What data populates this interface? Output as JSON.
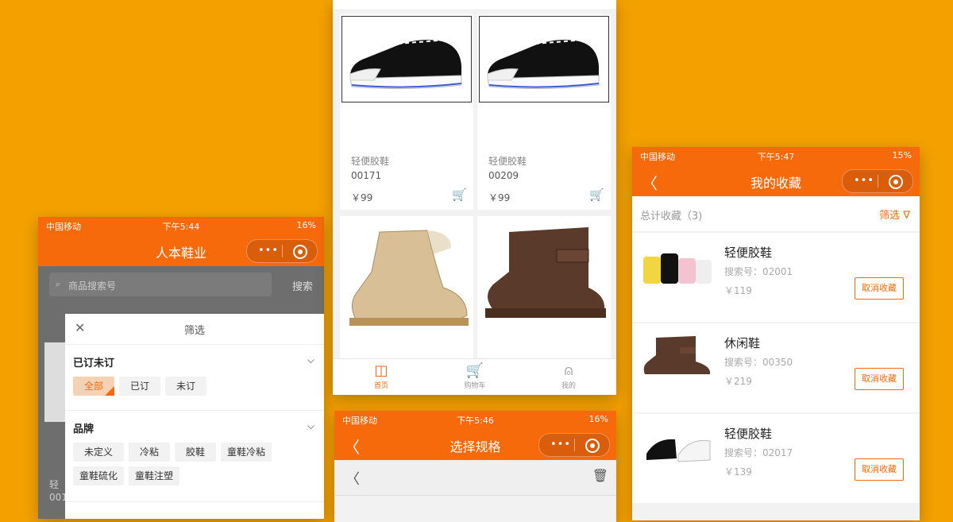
{
  "colors": {
    "background": "#F4A100",
    "brand": "#F76A0C"
  },
  "icons": {
    "close": "✕",
    "chevron_down": "⌵",
    "back": "〈",
    "cart": "🛒",
    "trash": "🗑",
    "filter": "∇",
    "search": "⌕",
    "signal": "ıll",
    "wifi": "◠"
  },
  "screen1": {
    "status": {
      "carrier": "中国移动",
      "time": "下午5:44",
      "battery": "16%"
    },
    "title": "人本鞋业",
    "search": {
      "placeholder": "商品搜索号",
      "button": "搜索"
    },
    "bg_text": {
      "line1": "轻",
      "line2": "001"
    },
    "filter": {
      "title": "筛选",
      "sections": [
        {
          "title": "已订未订",
          "options": [
            "全部",
            "已订",
            "未订"
          ],
          "selected": "全部"
        },
        {
          "title": "品牌",
          "options": [
            "未定义",
            "冷粘",
            "胶鞋",
            "童鞋冷粘",
            "童鞋硫化",
            "童鞋注塑"
          ]
        }
      ]
    }
  },
  "screen2": {
    "products": [
      {
        "name": "轻便胶鞋",
        "code": "00171",
        "price": "￥99"
      },
      {
        "name": "轻便胶鞋",
        "code": "00209",
        "price": "￥99"
      }
    ],
    "tabs": [
      {
        "label": "首页",
        "active": true
      },
      {
        "label": "购物车",
        "active": false
      },
      {
        "label": "我的",
        "active": false
      }
    ]
  },
  "screen3": {
    "status": {
      "carrier": "中国移动",
      "time": "下午5:46",
      "battery": "16%"
    },
    "title": "选择规格"
  },
  "screen4": {
    "status": {
      "carrier": "中国移动",
      "time": "下午5:47",
      "battery": "15%"
    },
    "title": "我的收藏",
    "total": "总计收藏（3)",
    "filter_label": "筛选",
    "items": [
      {
        "name": "轻便胶鞋",
        "code": "搜索号：02001",
        "price": "￥119",
        "action": "取消收藏"
      },
      {
        "name": "休闲鞋",
        "code": "搜索号：00350",
        "price": "￥219",
        "action": "取消收藏"
      },
      {
        "name": "轻便胶鞋",
        "code": "搜索号：02017",
        "price": "￥139",
        "action": "取消收藏"
      }
    ]
  }
}
